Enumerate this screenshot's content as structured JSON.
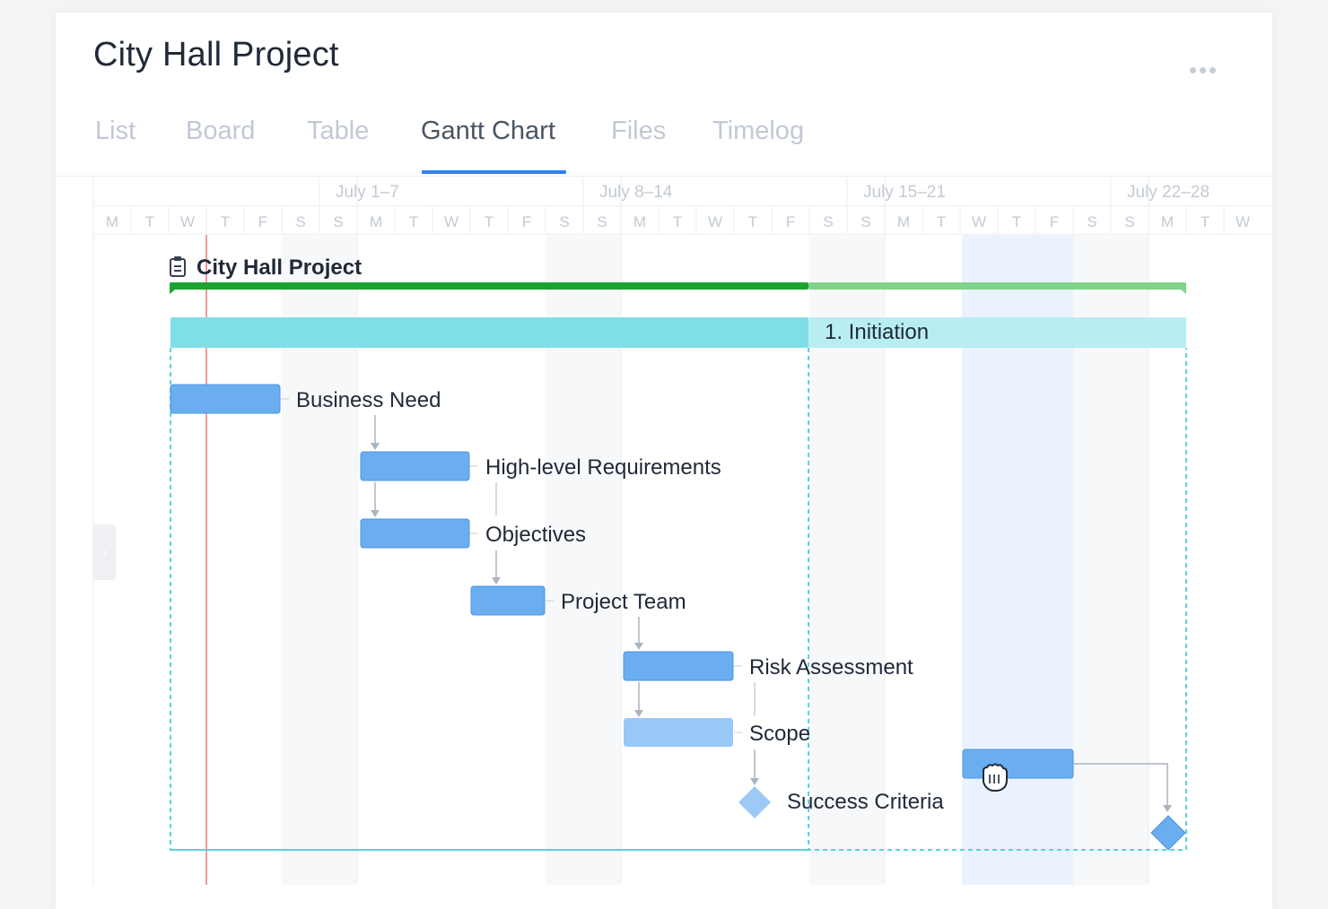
{
  "project": {
    "title": "City Hall Project"
  },
  "menu": {
    "more_icon": "more-horizontal-icon"
  },
  "tabs": [
    {
      "label": "List",
      "active": false
    },
    {
      "label": "Board",
      "active": false
    },
    {
      "label": "Table",
      "active": false
    },
    {
      "label": "Gantt Chart",
      "active": true
    },
    {
      "label": "Files",
      "active": false
    },
    {
      "label": "Timelog",
      "active": false
    }
  ],
  "timeline": {
    "weeks": [
      "July 1–7",
      "July 8–14",
      "July 15–21",
      "July 22–28"
    ],
    "days": [
      "M",
      "T",
      "W",
      "T",
      "F",
      "S",
      "S",
      "M",
      "T",
      "W",
      "T",
      "F",
      "S",
      "S",
      "M",
      "T",
      "W",
      "T",
      "F",
      "S",
      "S",
      "M",
      "T",
      "W",
      "T",
      "F",
      "S",
      "S",
      "M",
      "T",
      "W"
    ]
  },
  "colors": {
    "accent": "#2f80ed",
    "project_bar": "#1aa32f",
    "project_bar_light": "#7fd38a",
    "phase_bar": "#7fdfe8",
    "phase_bar_light": "#b8eef3",
    "task_bar": "#6aaef0",
    "task_bar_light": "#99c8f6",
    "today_line": "#f19a9a",
    "highlight_column": "#eaf3fd"
  },
  "gantt": {
    "project_label": "City Hall Project",
    "project_icon": "clipboard-icon",
    "phase_label": "1. Initiation",
    "tasks": [
      {
        "name": "Business Need"
      },
      {
        "name": "High-level Requirements"
      },
      {
        "name": "Objectives"
      },
      {
        "name": "Project Team"
      },
      {
        "name": "Risk Assessment"
      },
      {
        "name": "Scope"
      }
    ],
    "milestones": [
      {
        "name": "Success Criteria"
      },
      {
        "name": ""
      }
    ],
    "cursor_icon": "grab-hand-icon",
    "collapse_icon": "chevron-right-icon"
  }
}
